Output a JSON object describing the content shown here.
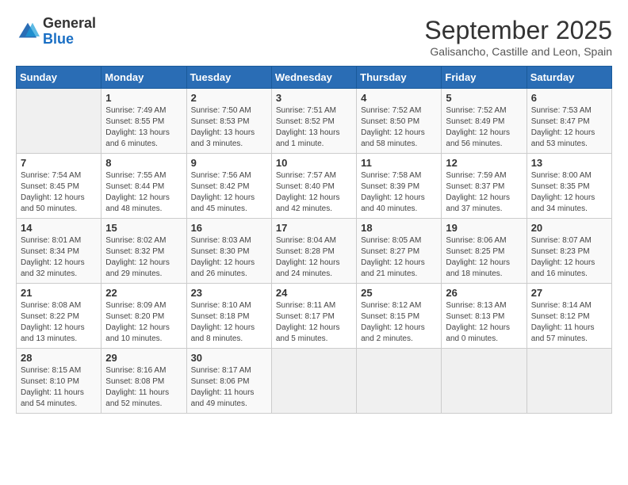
{
  "logo": {
    "general": "General",
    "blue": "Blue"
  },
  "header": {
    "month": "September 2025",
    "location": "Galisancho, Castille and Leon, Spain"
  },
  "weekdays": [
    "Sunday",
    "Monday",
    "Tuesday",
    "Wednesday",
    "Thursday",
    "Friday",
    "Saturday"
  ],
  "weeks": [
    [
      {
        "day": "",
        "info": ""
      },
      {
        "day": "1",
        "info": "Sunrise: 7:49 AM\nSunset: 8:55 PM\nDaylight: 13 hours\nand 6 minutes."
      },
      {
        "day": "2",
        "info": "Sunrise: 7:50 AM\nSunset: 8:53 PM\nDaylight: 13 hours\nand 3 minutes."
      },
      {
        "day": "3",
        "info": "Sunrise: 7:51 AM\nSunset: 8:52 PM\nDaylight: 13 hours\nand 1 minute."
      },
      {
        "day": "4",
        "info": "Sunrise: 7:52 AM\nSunset: 8:50 PM\nDaylight: 12 hours\nand 58 minutes."
      },
      {
        "day": "5",
        "info": "Sunrise: 7:52 AM\nSunset: 8:49 PM\nDaylight: 12 hours\nand 56 minutes."
      },
      {
        "day": "6",
        "info": "Sunrise: 7:53 AM\nSunset: 8:47 PM\nDaylight: 12 hours\nand 53 minutes."
      }
    ],
    [
      {
        "day": "7",
        "info": "Sunrise: 7:54 AM\nSunset: 8:45 PM\nDaylight: 12 hours\nand 50 minutes."
      },
      {
        "day": "8",
        "info": "Sunrise: 7:55 AM\nSunset: 8:44 PM\nDaylight: 12 hours\nand 48 minutes."
      },
      {
        "day": "9",
        "info": "Sunrise: 7:56 AM\nSunset: 8:42 PM\nDaylight: 12 hours\nand 45 minutes."
      },
      {
        "day": "10",
        "info": "Sunrise: 7:57 AM\nSunset: 8:40 PM\nDaylight: 12 hours\nand 42 minutes."
      },
      {
        "day": "11",
        "info": "Sunrise: 7:58 AM\nSunset: 8:39 PM\nDaylight: 12 hours\nand 40 minutes."
      },
      {
        "day": "12",
        "info": "Sunrise: 7:59 AM\nSunset: 8:37 PM\nDaylight: 12 hours\nand 37 minutes."
      },
      {
        "day": "13",
        "info": "Sunrise: 8:00 AM\nSunset: 8:35 PM\nDaylight: 12 hours\nand 34 minutes."
      }
    ],
    [
      {
        "day": "14",
        "info": "Sunrise: 8:01 AM\nSunset: 8:34 PM\nDaylight: 12 hours\nand 32 minutes."
      },
      {
        "day": "15",
        "info": "Sunrise: 8:02 AM\nSunset: 8:32 PM\nDaylight: 12 hours\nand 29 minutes."
      },
      {
        "day": "16",
        "info": "Sunrise: 8:03 AM\nSunset: 8:30 PM\nDaylight: 12 hours\nand 26 minutes."
      },
      {
        "day": "17",
        "info": "Sunrise: 8:04 AM\nSunset: 8:28 PM\nDaylight: 12 hours\nand 24 minutes."
      },
      {
        "day": "18",
        "info": "Sunrise: 8:05 AM\nSunset: 8:27 PM\nDaylight: 12 hours\nand 21 minutes."
      },
      {
        "day": "19",
        "info": "Sunrise: 8:06 AM\nSunset: 8:25 PM\nDaylight: 12 hours\nand 18 minutes."
      },
      {
        "day": "20",
        "info": "Sunrise: 8:07 AM\nSunset: 8:23 PM\nDaylight: 12 hours\nand 16 minutes."
      }
    ],
    [
      {
        "day": "21",
        "info": "Sunrise: 8:08 AM\nSunset: 8:22 PM\nDaylight: 12 hours\nand 13 minutes."
      },
      {
        "day": "22",
        "info": "Sunrise: 8:09 AM\nSunset: 8:20 PM\nDaylight: 12 hours\nand 10 minutes."
      },
      {
        "day": "23",
        "info": "Sunrise: 8:10 AM\nSunset: 8:18 PM\nDaylight: 12 hours\nand 8 minutes."
      },
      {
        "day": "24",
        "info": "Sunrise: 8:11 AM\nSunset: 8:17 PM\nDaylight: 12 hours\nand 5 minutes."
      },
      {
        "day": "25",
        "info": "Sunrise: 8:12 AM\nSunset: 8:15 PM\nDaylight: 12 hours\nand 2 minutes."
      },
      {
        "day": "26",
        "info": "Sunrise: 8:13 AM\nSunset: 8:13 PM\nDaylight: 12 hours\nand 0 minutes."
      },
      {
        "day": "27",
        "info": "Sunrise: 8:14 AM\nSunset: 8:12 PM\nDaylight: 11 hours\nand 57 minutes."
      }
    ],
    [
      {
        "day": "28",
        "info": "Sunrise: 8:15 AM\nSunset: 8:10 PM\nDaylight: 11 hours\nand 54 minutes."
      },
      {
        "day": "29",
        "info": "Sunrise: 8:16 AM\nSunset: 8:08 PM\nDaylight: 11 hours\nand 52 minutes."
      },
      {
        "day": "30",
        "info": "Sunrise: 8:17 AM\nSunset: 8:06 PM\nDaylight: 11 hours\nand 49 minutes."
      },
      {
        "day": "",
        "info": ""
      },
      {
        "day": "",
        "info": ""
      },
      {
        "day": "",
        "info": ""
      },
      {
        "day": "",
        "info": ""
      }
    ]
  ]
}
